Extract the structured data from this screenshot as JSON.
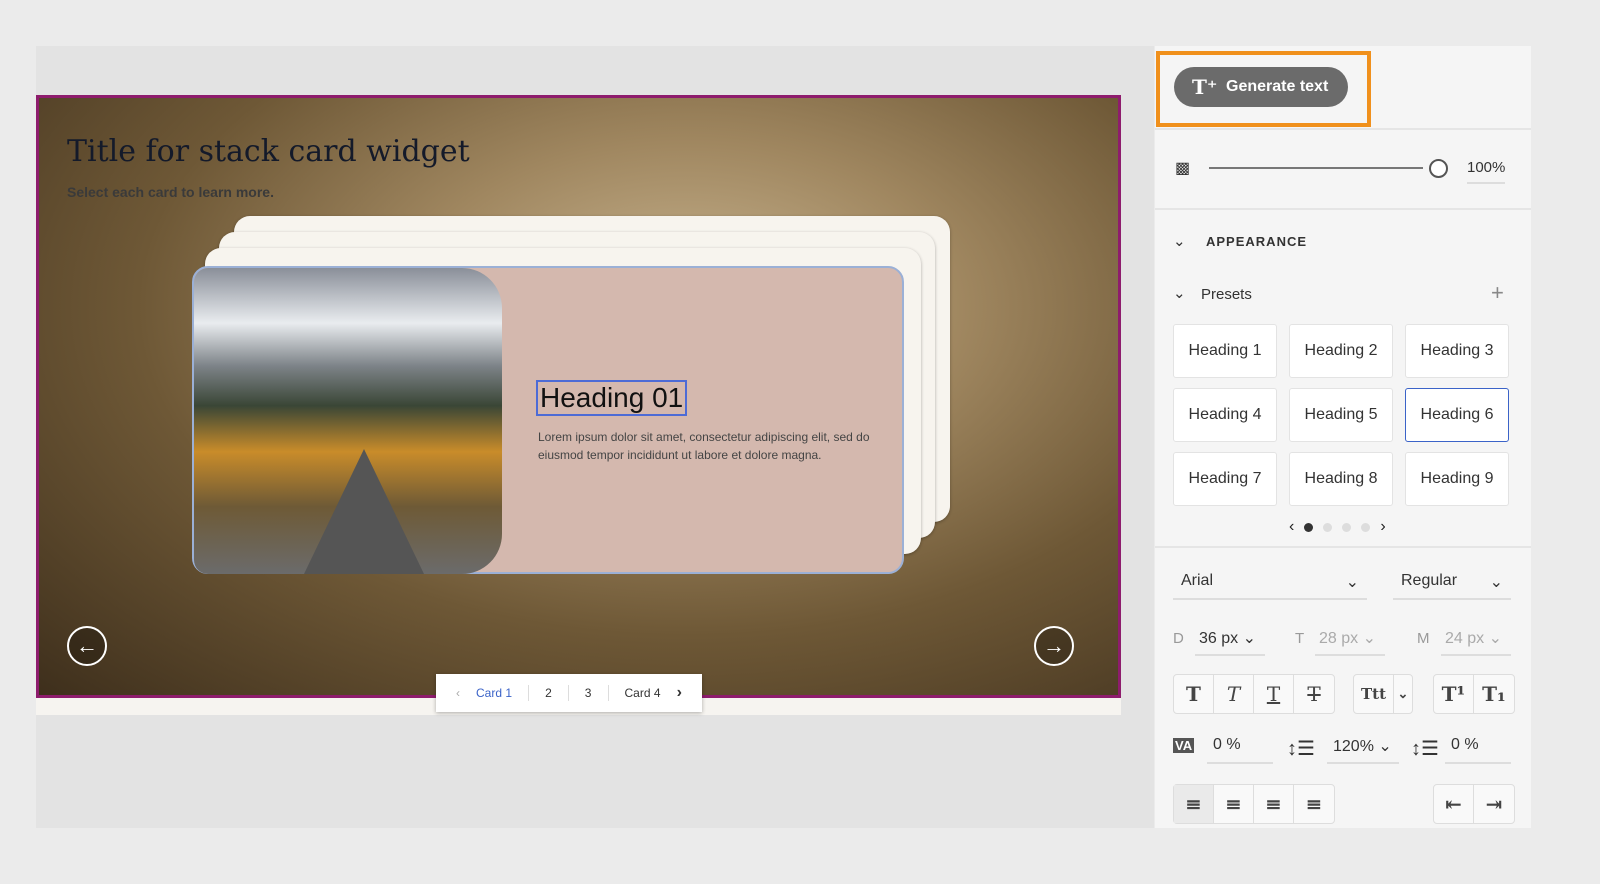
{
  "stage": {
    "title": "Title for stack card widget",
    "subtitle": "Select each card to learn more.",
    "card": {
      "heading": "Heading 01",
      "body": "Lorem ipsum dolor sit amet, consectetur adipiscing elit, sed do eiusmod tempor incididunt ut labore et dolore magna."
    },
    "pager": {
      "items": [
        "Card 1",
        "2",
        "3",
        "Card 4"
      ],
      "active": "Card 1"
    }
  },
  "panel": {
    "generate_label": "Generate text",
    "opacity": "100%",
    "appearance": "APPEARANCE",
    "presets_label": "Presets",
    "presets": [
      "Heading 1",
      "Heading 2",
      "Heading 3",
      "Heading 4",
      "Heading 5",
      "Heading 6",
      "Heading 7",
      "Heading 8",
      "Heading 9"
    ],
    "selected_preset": "Heading 6",
    "font": "Arial",
    "weight": "Regular",
    "sizes": [
      {
        "label": "D",
        "value": "36 px"
      },
      {
        "label": "T",
        "value": "28 px"
      },
      {
        "label": "M",
        "value": "24 px"
      }
    ],
    "tracking": "0 %",
    "line_height": "120%",
    "para_spacing": "0 %"
  },
  "colors": {
    "accent": "#f0901c",
    "border": "#8e1c6d",
    "link": "#3b63c8"
  }
}
